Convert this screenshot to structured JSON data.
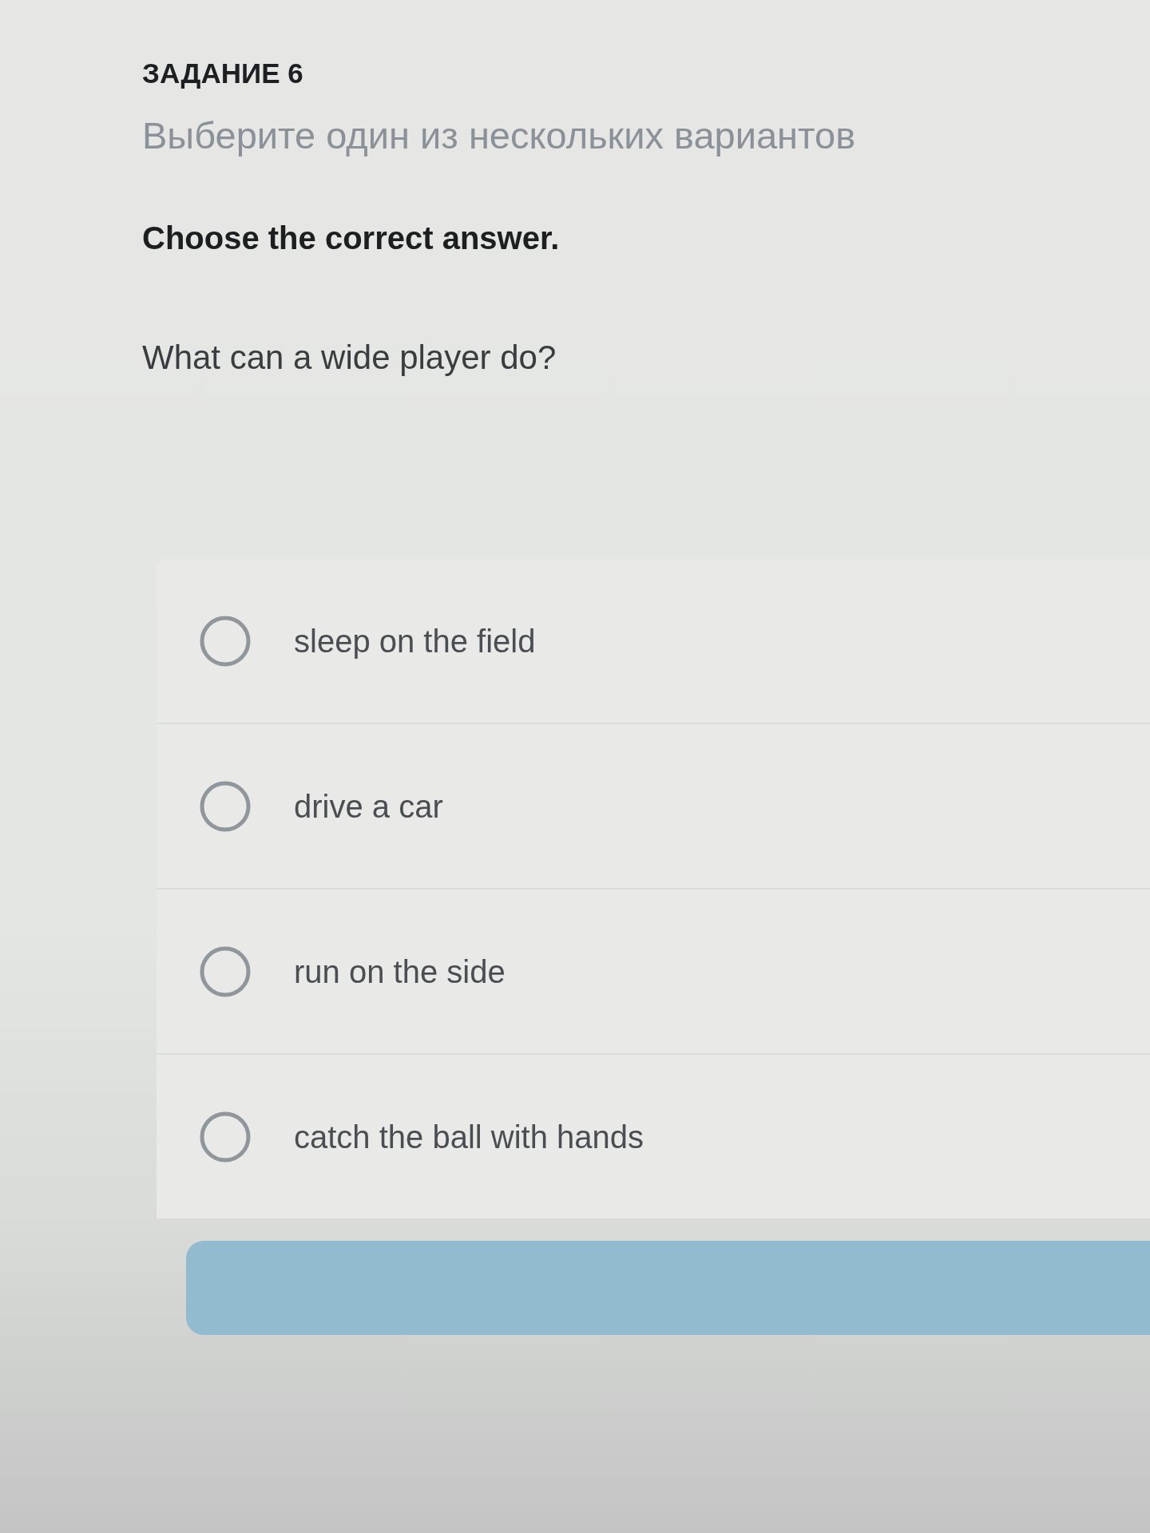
{
  "task": {
    "title": "ЗАДАНИЕ 6",
    "subtitle": "Выберите один из нескольких вариантов",
    "instruction": "Choose the correct answer.",
    "question": "What can a wide player do?"
  },
  "options": [
    {
      "label": "sleep on the field",
      "selected": false
    },
    {
      "label": "drive a car",
      "selected": false
    },
    {
      "label": "run on the side",
      "selected": false
    },
    {
      "label": "catch the ball with hands",
      "selected": false
    }
  ],
  "action_button": {
    "disabled": true
  }
}
